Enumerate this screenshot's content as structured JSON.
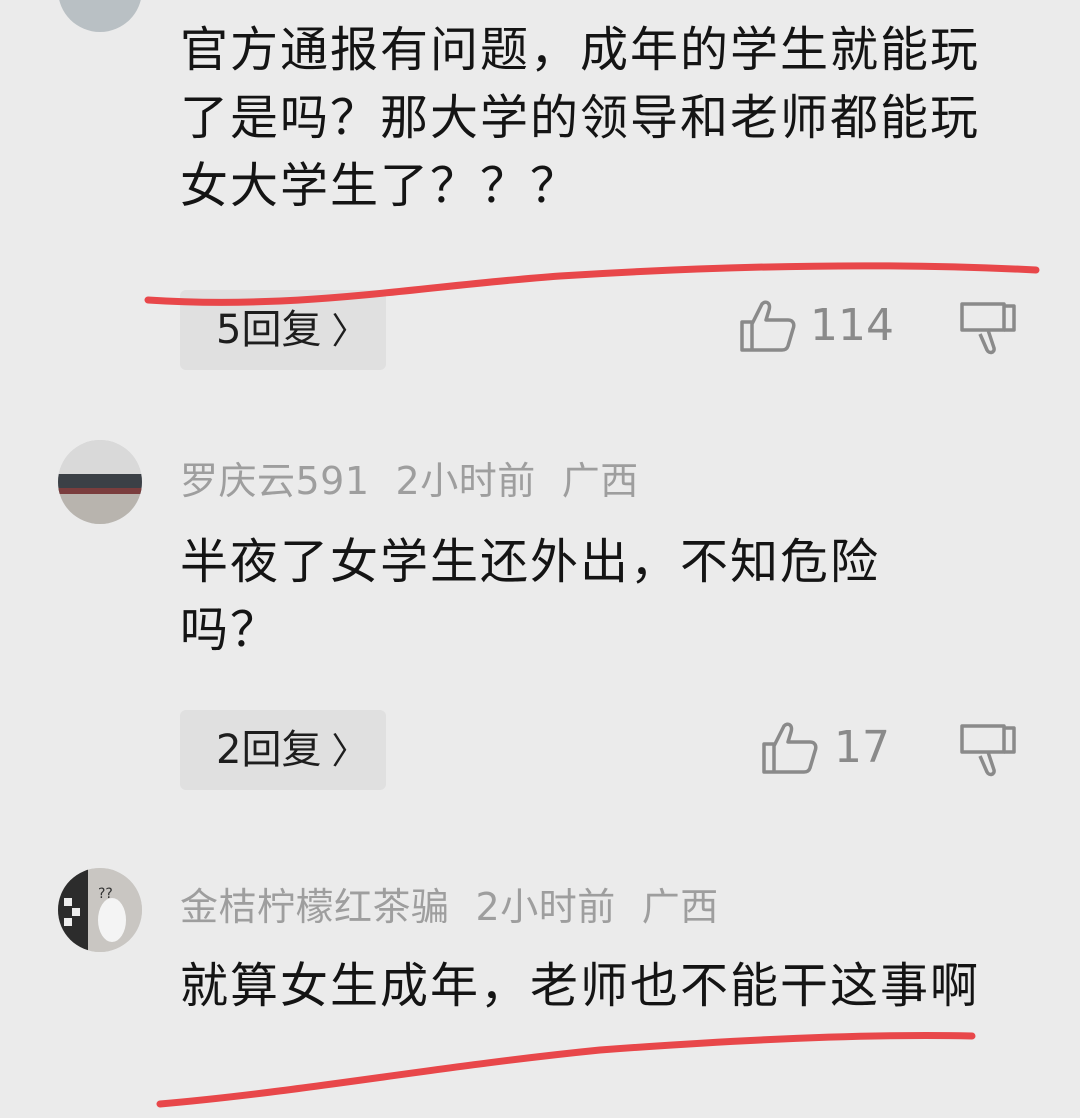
{
  "comments": [
    {
      "text": "官方通报有问题，成年的学生就能玩了是吗？那大学的领导和老师都能玩女大学生了？？？",
      "replies_label": "5回复",
      "likes": "114"
    },
    {
      "username": "罗庆云591",
      "time": "2小时前",
      "location": "广西",
      "text": "半夜了女学生还外出，不知危险吗？",
      "replies_label": "2回复",
      "likes": "17"
    },
    {
      "username": "金桔柠檬红茶骗",
      "time": "2小时前",
      "location": "广西",
      "text": "就算女生成年，老师也不能干这事啊"
    }
  ],
  "icons": {
    "chevron": "chevron-right-icon",
    "like": "thumbs-up-icon",
    "dislike": "thumbs-down-icon"
  },
  "colors": {
    "background": "#ebebeb",
    "meta_text": "#9e9e9e",
    "annotation_underline": "#e8474a"
  }
}
